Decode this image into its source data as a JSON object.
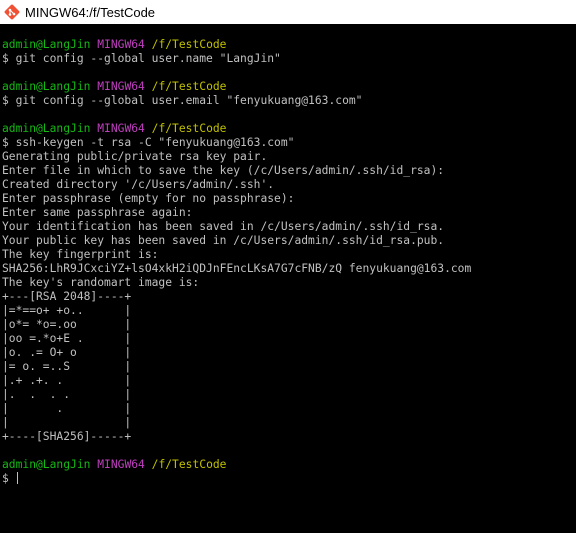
{
  "window": {
    "title": "MINGW64:/f/TestCode",
    "app_icon": "git-bash-icon"
  },
  "colors": {
    "background": "#000000",
    "text": "#c0c0c0",
    "user": "#14b814",
    "host": "#bf3fbf",
    "path": "#c0c000"
  },
  "prompts": [
    {
      "user": "admin@LangJin",
      "host": "MINGW64",
      "path": "/f/TestCode",
      "command": "$ git config --global user.name \"LangJin\""
    },
    {
      "user": "admin@LangJin",
      "host": "MINGW64",
      "path": "/f/TestCode",
      "command": "$ git config --global user.email \"fenyukuang@163.com\""
    },
    {
      "user": "admin@LangJin",
      "host": "MINGW64",
      "path": "/f/TestCode",
      "command": "$ ssh-keygen -t rsa -C \"fenyukuang@163.com\""
    },
    {
      "user": "admin@LangJin",
      "host": "MINGW64",
      "path": "/f/TestCode",
      "command": "$ "
    }
  ],
  "output": [
    "Generating public/private rsa key pair.",
    "Enter file in which to save the key (/c/Users/admin/.ssh/id_rsa):",
    "Created directory '/c/Users/admin/.ssh'.",
    "Enter passphrase (empty for no passphrase):",
    "Enter same passphrase again:",
    "Your identification has been saved in /c/Users/admin/.ssh/id_rsa.",
    "Your public key has been saved in /c/Users/admin/.ssh/id_rsa.pub.",
    "The key fingerprint is:",
    "SHA256:LhR9JCxciYZ+lsO4xkH2iQDJnFEncLKsA7G7cFNB/zQ fenyukuang@163.com",
    "The key's randomart image is:",
    "+---[RSA 2048]----+",
    "|=*==o+ +o..      |",
    "|o*= *o=.oo       |",
    "|oo =.*o+E .      |",
    "|o. .= O+ o       |",
    "|= o. =..S        |",
    "|.+ .+. .         |",
    "|.  .  . .        |",
    "|       .         |",
    "|                 |",
    "+----[SHA256]-----+"
  ]
}
